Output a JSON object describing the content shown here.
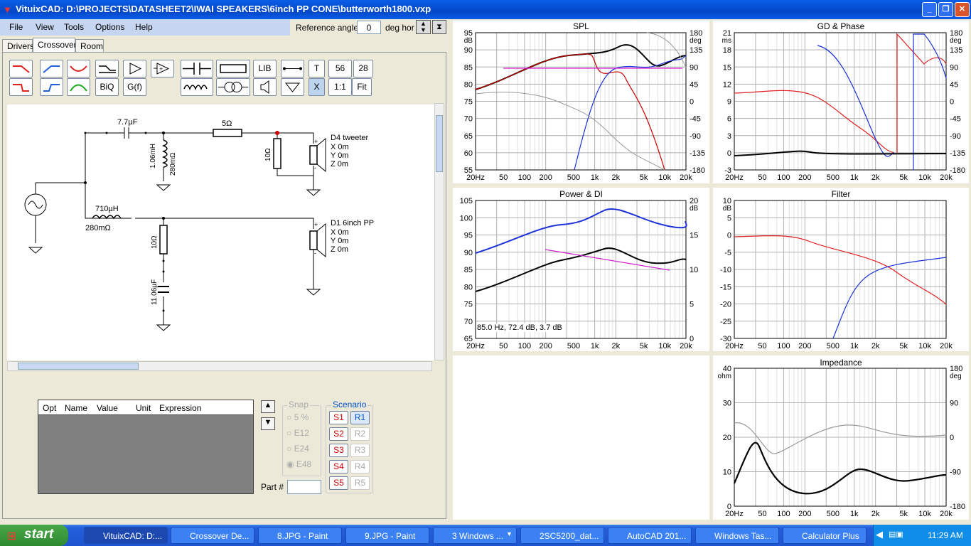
{
  "window": {
    "title": "VituixCAD: D:\\PROJECTS\\DATASHEET2\\IWAI SPEAKERS\\6inch PP CONE\\butterworth1800.vxp"
  },
  "menu": [
    "File",
    "View",
    "Tools",
    "Options",
    "Help"
  ],
  "reference": {
    "label": "Reference angle",
    "value": "0",
    "unit": "deg hor"
  },
  "tabs": [
    "Drivers",
    "Crossover",
    "Room"
  ],
  "toolbar": {
    "lib": "LIB",
    "t": "T",
    "n56": "56",
    "n28": "28",
    "biq": "BiQ",
    "gf": "G(f)",
    "x": "X",
    "one": "1:1",
    "fit": "Fit"
  },
  "schematic": {
    "c1": "7.7µF",
    "l1": "1.06mH",
    "l1r": "280mΩ",
    "r_series": "5Ω",
    "r_shunt": "10Ω",
    "tweeter": {
      "name": "D4 tweeter",
      "x": "X 0m",
      "y": "Y 0m",
      "z": "Z 0m"
    },
    "l2": "710µH",
    "l2r": "280mΩ",
    "r2": "10Ω",
    "c2": "11.06µF",
    "woofer": {
      "name": "D1 6inch PP",
      "x": "X 0m",
      "y": "Y 0m",
      "z": "Z 0m"
    }
  },
  "grid": {
    "columns": [
      "Opt",
      "Name",
      "Value",
      "Unit",
      "Expression"
    ]
  },
  "snap": {
    "title": "Snap",
    "options": [
      "5 %",
      "E12",
      "E24",
      "E48"
    ]
  },
  "scenario": {
    "title": "Scenario",
    "s": [
      "S1",
      "S2",
      "S3",
      "S4",
      "S5"
    ],
    "r": [
      "R1",
      "R2",
      "R3",
      "R4",
      "R5"
    ]
  },
  "part": {
    "label": "Part #"
  },
  "xticks": [
    "20Hz",
    "50",
    "100",
    "200",
    "500",
    "1k",
    "2k",
    "5k",
    "10k",
    "20k"
  ],
  "charts": {
    "spl": {
      "title": "SPL",
      "left_unit": "dB",
      "right_unit": "deg",
      "left": [
        "95",
        "90",
        "85",
        "80",
        "75",
        "70",
        "65",
        "60",
        "55"
      ],
      "right": [
        "180",
        "135",
        "90",
        "45",
        "0",
        "-45",
        "-90",
        "-135",
        "-180"
      ]
    },
    "gd": {
      "title": "GD & Phase",
      "left_unit": "ms",
      "right_unit": "deg",
      "left": [
        "21",
        "18",
        "15",
        "12",
        "9",
        "6",
        "3",
        "0",
        "-3"
      ],
      "right": [
        "180",
        "135",
        "90",
        "45",
        "0",
        "-45",
        "-90",
        "-135",
        "-180"
      ]
    },
    "power": {
      "title": "Power & DI",
      "left_unit": "",
      "right_unit": "dB",
      "left": [
        "105",
        "100",
        "95",
        "90",
        "85",
        "80",
        "75",
        "70",
        "65"
      ],
      "right": [
        "20",
        "15",
        "10",
        "5",
        "0"
      ],
      "readout": "85.0 Hz, 72.4 dB, 3.7 dB"
    },
    "filter": {
      "title": "Filter",
      "left_unit": "dB",
      "left": [
        "10",
        "5",
        "0",
        "-5",
        "-10",
        "-15",
        "-20",
        "-25",
        "-30"
      ]
    },
    "impedance": {
      "title": "Impedance",
      "left_unit": "ohm",
      "right_unit": "deg",
      "left": [
        "40",
        "30",
        "20",
        "10",
        "0"
      ],
      "right": [
        "180",
        "90",
        "0",
        "-90",
        "-180"
      ]
    }
  },
  "taskbar": {
    "start": "start",
    "items": [
      "VituixCAD: D:...",
      "Crossover De...",
      "8.JPG - Paint",
      "9.JPG - Paint",
      "3 Windows ...",
      "2SC5200_dat...",
      "AutoCAD 201...",
      "Windows Tas...",
      "Calculator Plus"
    ],
    "clock": "11:29 AM"
  }
}
